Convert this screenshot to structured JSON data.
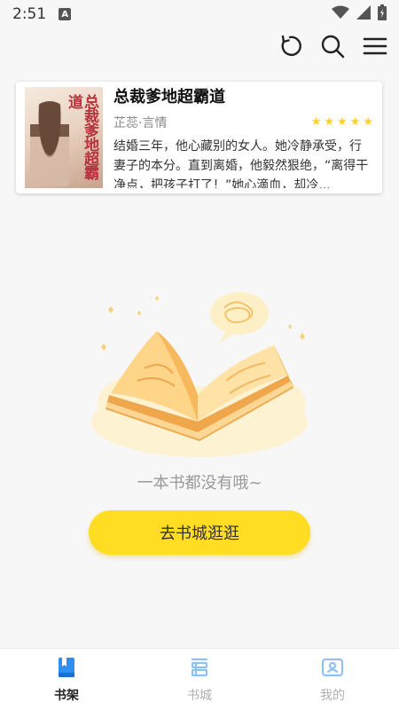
{
  "status_bar": {
    "time": "2:51",
    "notification_letter": "A"
  },
  "toolbar": {
    "icons": [
      "refresh-icon",
      "search-icon",
      "menu-icon"
    ]
  },
  "book": {
    "cover_title": "总裁爹地超霸道",
    "title": "总裁爹地超霸道",
    "meta": "芷蕊·言情",
    "rating_stars": 5,
    "description": "结婚三年，他心藏别的女人。她冷静承受，行妻子的本分。直到离婚，他毅然狠绝，“离得干净点，把孩子打了！”她心滴血，却冷..."
  },
  "empty_state": {
    "message": "一本书都没有哦~",
    "button_label": "去书城逛逛"
  },
  "bottom_nav": {
    "items": [
      {
        "label": "书架",
        "icon": "bookshelf-icon",
        "active": true
      },
      {
        "label": "书城",
        "icon": "bookstore-icon",
        "active": false
      },
      {
        "label": "我的",
        "icon": "profile-icon",
        "active": false
      }
    ]
  },
  "colors": {
    "accent_yellow": "#ffdd22",
    "nav_active_blue": "#2f8ff0",
    "nav_inactive_blue": "#8ec2f5",
    "star": "#ffd21f"
  }
}
